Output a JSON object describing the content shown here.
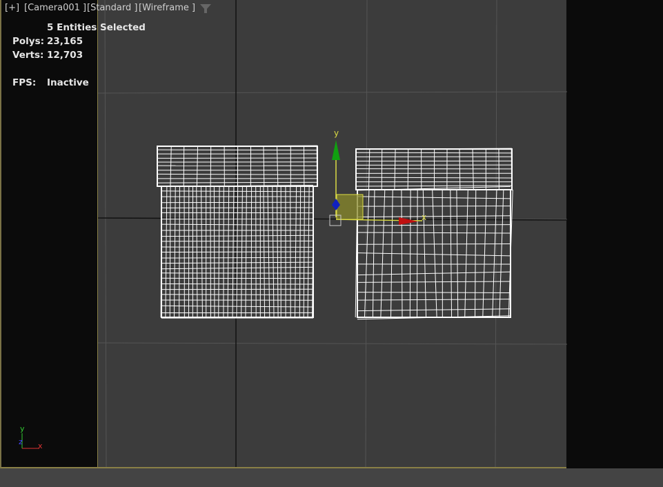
{
  "viewport": {
    "menu_plus": "[+]",
    "camera": "[Camera001 ]",
    "shading_standard": "[Standard ]",
    "shading_mode": "[Wireframe ]",
    "filter_icon": "funnel-icon"
  },
  "stats": {
    "selection": "5 Entities Selected",
    "polys_label": "Polys:",
    "polys_value": "23,165",
    "verts_label": "Verts:",
    "verts_value": "12,703",
    "fps_label": "FPS:",
    "fps_value": "Inactive"
  },
  "gizmo": {
    "y_label": "y",
    "x_label": "x",
    "colors": {
      "x": "#c01010",
      "y": "#10a010",
      "z": "#1020c0",
      "plane": "#8a8a2a"
    }
  },
  "axis_tripod": {
    "y": "y",
    "z": "z",
    "x": "x"
  }
}
